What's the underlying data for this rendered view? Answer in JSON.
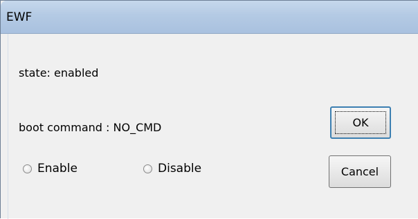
{
  "window": {
    "title": "EWF"
  },
  "status": {
    "state_text": "state: enabled",
    "boot_command_text": "boot command : NO_CMD"
  },
  "options": {
    "enable_label": "Enable",
    "disable_label": "Disable",
    "selected": "none"
  },
  "buttons": {
    "ok_label": "OK",
    "cancel_label": "Cancel"
  }
}
